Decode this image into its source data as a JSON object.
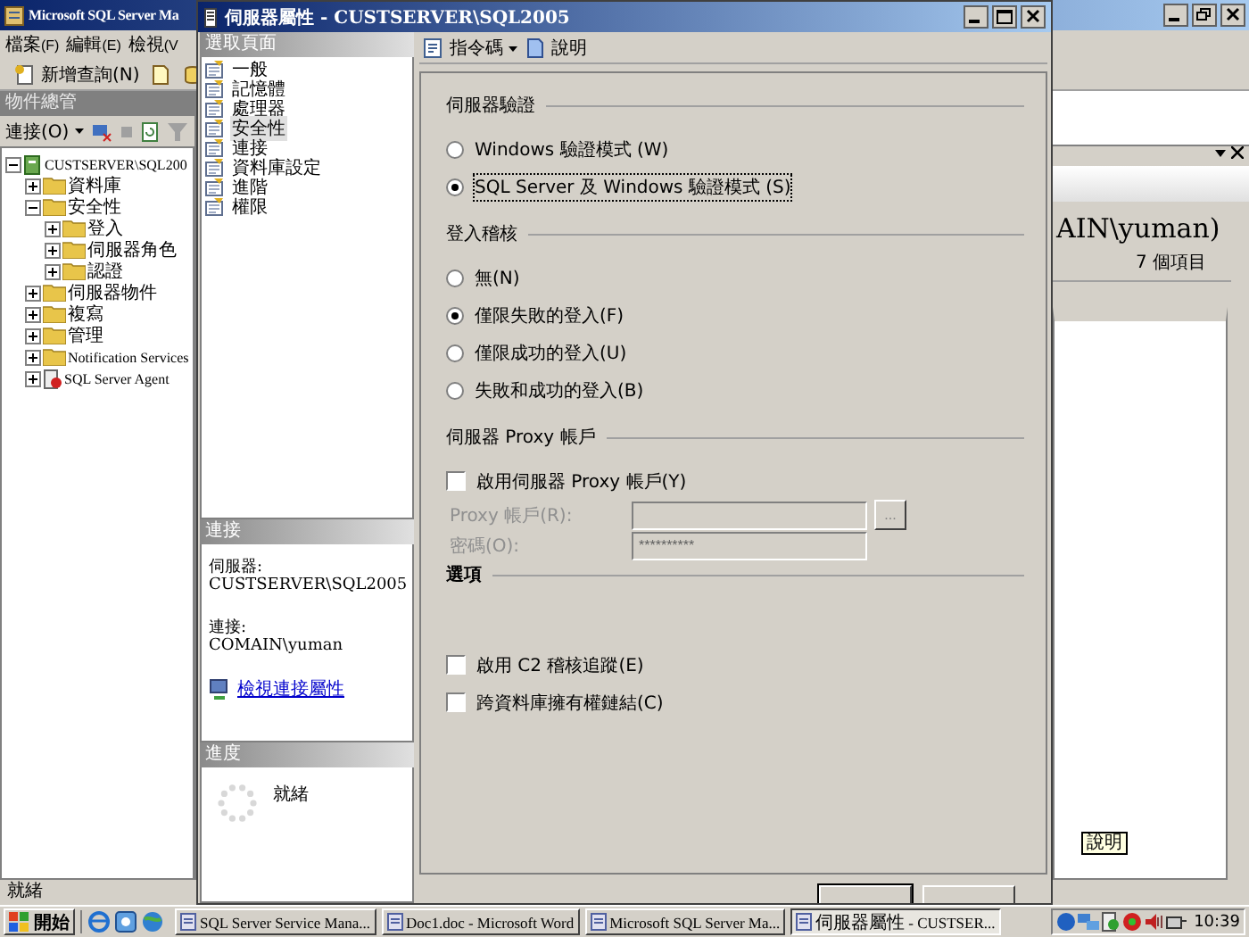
{
  "main_window": {
    "title": "Microsoft SQL Server Ma",
    "menu": [
      "檔案(F)",
      "編輯(E)",
      "檢視(V"
    ],
    "toolbar": {
      "new_query": "新增查詢(N)"
    },
    "object_explorer": {
      "title": "物件總管",
      "connect": "連接(O)",
      "tree": [
        {
          "label": "CUSTSERVER\\SQL200",
          "kind": "server",
          "expanded": true,
          "children": [
            {
              "label": "資料庫",
              "kind": "folder",
              "expanded": false
            },
            {
              "label": "安全性",
              "kind": "folder",
              "expanded": true,
              "children": [
                {
                  "label": "登入",
                  "kind": "folder",
                  "expanded": false
                },
                {
                  "label": "伺服器角色",
                  "kind": "folder",
                  "expanded": false
                },
                {
                  "label": "認證",
                  "kind": "folder",
                  "expanded": false
                }
              ]
            },
            {
              "label": "伺服器物件",
              "kind": "folder",
              "expanded": false
            },
            {
              "label": "複寫",
              "kind": "folder",
              "expanded": false
            },
            {
              "label": "管理",
              "kind": "folder",
              "expanded": false
            },
            {
              "label": "Notification Services",
              "kind": "folder",
              "expanded": false
            },
            {
              "label": "SQL Server Agent",
              "kind": "agent",
              "expanded": false
            }
          ]
        }
      ]
    },
    "summary": {
      "heading": "AIN\\yuman)",
      "count": "7 個項目"
    },
    "status_bar": "就緒"
  },
  "dialog": {
    "title": "伺服器屬性 - CUSTSERVER\\SQL2005",
    "select_page": {
      "title": "選取頁面",
      "pages": [
        {
          "label": "一般",
          "selected": false
        },
        {
          "label": "記憶體",
          "selected": false
        },
        {
          "label": "處理器",
          "selected": false
        },
        {
          "label": "安全性",
          "selected": true
        },
        {
          "label": "連接",
          "selected": false
        },
        {
          "label": "資料庫設定",
          "selected": false
        },
        {
          "label": "進階",
          "selected": false
        },
        {
          "label": "權限",
          "selected": false
        }
      ]
    },
    "connection": {
      "title": "連接",
      "server_label": "伺服器:",
      "server": "CUSTSERVER\\SQL2005",
      "connection_label": "連接:",
      "connection": "COMAIN\\yuman",
      "link": "檢視連接屬性"
    },
    "progress": {
      "title": "進度",
      "status": "就緒"
    },
    "toolbar": {
      "script": "指令碼",
      "help": "說明"
    },
    "groups": [
      {
        "title": "伺服器驗證",
        "items": [
          {
            "kind": "radio",
            "label": "Windows 驗證模式 (W)",
            "selected": false
          },
          {
            "kind": "radio",
            "label": "SQL Server 及 Windows 驗證模式 (S)",
            "selected": true
          }
        ]
      },
      {
        "title": "登入稽核",
        "items": [
          {
            "kind": "radio",
            "label": "無(N)",
            "selected": false
          },
          {
            "kind": "radio",
            "label": "僅限失敗的登入(F)",
            "selected": true
          },
          {
            "kind": "radio",
            "label": "僅限成功的登入(U)",
            "selected": false
          },
          {
            "kind": "radio",
            "label": "失敗和成功的登入(B)",
            "selected": false
          }
        ]
      },
      {
        "title": "伺服器 Proxy 帳戶",
        "items": [
          {
            "kind": "checkbox",
            "label": "啟用伺服器 Proxy 帳戶(Y)",
            "checked": false
          },
          {
            "kind": "field",
            "label": "Proxy 帳戶(R):",
            "browse": "...",
            "disabled": true
          },
          {
            "kind": "field",
            "label": "密碼(O):",
            "value": "**********",
            "disabled": true
          }
        ]
      },
      {
        "title": "選項",
        "items": [
          {
            "kind": "checkbox",
            "label": "啟用 C2 稽核追蹤(E)",
            "checked": false
          },
          {
            "kind": "checkbox",
            "label": "跨資料庫擁有權鏈結(C)",
            "checked": false
          }
        ]
      }
    ]
  },
  "tooltip": "說明",
  "taskbar": {
    "start": "開始",
    "tasks": [
      {
        "label": "SQL Server Service Mana...",
        "selected": false
      },
      {
        "label": "Doc1.doc - Microsoft Word",
        "selected": false
      },
      {
        "label": "Microsoft SQL Server Ma...",
        "selected": false
      },
      {
        "label": "伺服器屬性 - CUSTSER...",
        "selected": true
      }
    ],
    "clock": "10:39"
  }
}
